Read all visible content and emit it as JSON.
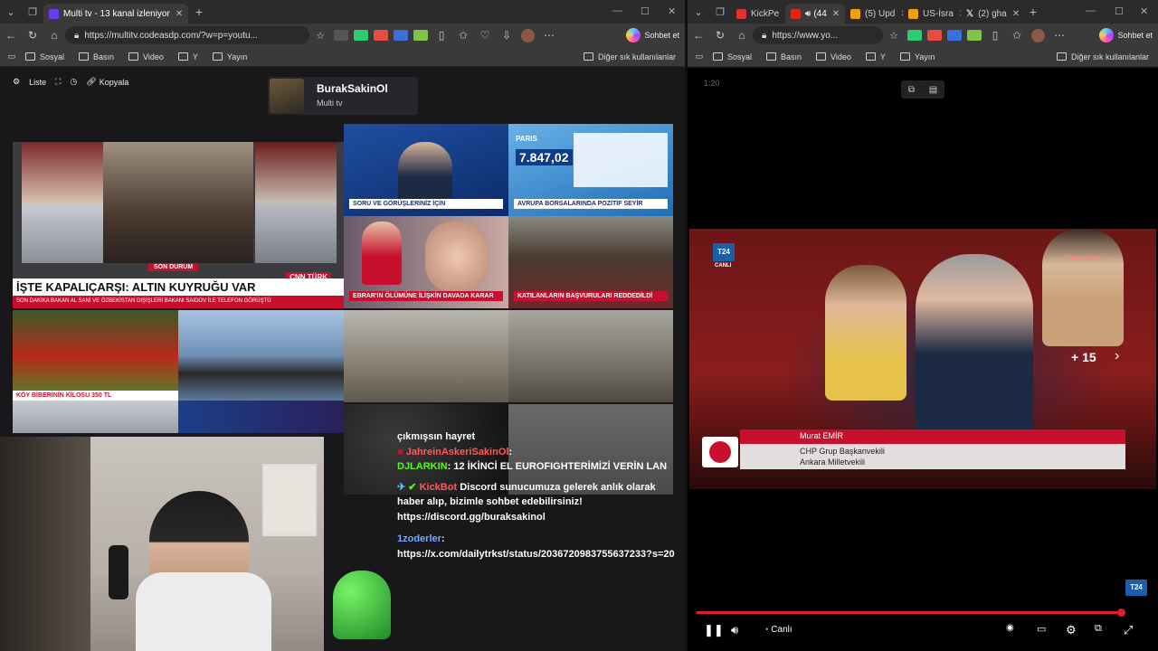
{
  "left_window": {
    "tabs": [
      {
        "title": "Multi tv - 13 kanal izleniyor",
        "active": true,
        "color": "#6a3df0"
      }
    ],
    "url": "https://multitv.codeasdp.com/?w=p=youtu...",
    "copilot_label": "Sohbet et",
    "favorites": [
      "Sosyal",
      "Basın",
      "Video",
      "Y",
      "Yayın"
    ],
    "other_favorites": "Diğer sık kullanılanlar",
    "toolbar": {
      "list_label": "Liste",
      "copy_label": "Kopyala"
    },
    "channel": {
      "name": "BurakSakinOl",
      "subtitle": "Multi tv"
    },
    "tiles": {
      "cnn_headline": "İŞTE KAPALIÇARŞI: ALTIN KUYRUĞU VAR",
      "cnn_status": "SON DURUM",
      "cnn_ticker": "SON DAKİKA  BAKAN AL SANİ VE ÖZBEKİSTAN DIŞİŞLERİ BAKANI SAIDOV İLE TELEFON GÖRÜŞTÜ",
      "cnn_brand": "CNN TÜRK",
      "cnn_live": "CANLI",
      "ntv_banner": "SORU VE GÖRÜŞLERİNİZ İÇİN",
      "market_banner": "AVRUPA BORSALARINDA POZİTİF SEYİR",
      "market_city": "PARIS",
      "market_value": "7.847,02",
      "haber_banner": "EBRAR'IN ÖLÜMÜNE İLİŞKİN DAVADA KARAR",
      "crowd_banner": "KATILANLARIN BAŞVURULARI REDDEDİLDİ",
      "veg_banner": "KÖY BİBERİNİN KİLOSU 350 TL"
    },
    "chat": {
      "partial_line": "çıkmışsın hayret",
      "messages": [
        {
          "user": "JahreinAskeriSakinOl",
          "text": ""
        },
        {
          "user": "DJLARKIN",
          "text": "12 İKİNCİ EL EUROFIGHTERİMİZİ VERİN LAN"
        },
        {
          "user": "KickBot",
          "text": "Discord sunucumuza gelerek anlık olarak haber alıp, bizimle sohbet edebilirsiniz! https://discord.gg/buraksakinol"
        },
        {
          "user": "1zoderler",
          "text": "https://x.com/dailytrkst/status/2036720983755637233?s=20"
        }
      ]
    }
  },
  "right_window": {
    "tabs": [
      {
        "title": "KickPe",
        "color": "#d33"
      },
      {
        "title": "(44",
        "color": "#e62117",
        "active": true
      },
      {
        "title": "(5) Upd",
        "color": "#f59e0b"
      },
      {
        "title": "US-İsra",
        "color": "#f59e0b"
      },
      {
        "title": "(2) gha",
        "color": "#111"
      }
    ],
    "url": "https://www.yo...",
    "copilot_label": "Sohbet et",
    "favorites": [
      "Sosyal",
      "Basın",
      "Video",
      "Y",
      "Yayın"
    ],
    "other_favorites": "Diğer sık kullanılanlar",
    "timestamp": "1:20",
    "video": {
      "channel_logo": "T24",
      "live_tag": "CANLI",
      "tbmm_tag": "TBMM CANLI",
      "more_count": "+ 15",
      "speaker_name": "Murat EMİR",
      "speaker_title1": "CHP Grup Başkanvekili",
      "speaker_title2": "Ankara Milletvekili"
    },
    "player": {
      "live_label": "Canlı",
      "progress": 0.96,
      "corner_logo": "T24"
    }
  }
}
